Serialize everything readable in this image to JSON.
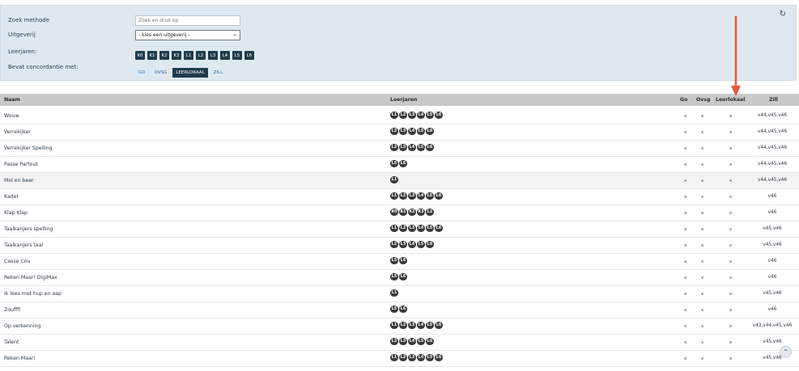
{
  "filters": {
    "search_label": "Zoek methode",
    "search_placeholder": "Zoek en druk op",
    "publisher_label": "Uitgeverij",
    "publisher_value": "- kies een uitgeverij -",
    "years_label": "Leerjaren:",
    "years": [
      "K0",
      "K1",
      "K2",
      "K3",
      "L1",
      "L2",
      "L3",
      "L4",
      "L5",
      "L6"
    ],
    "concordance_label": "Bevat concordantie met:",
    "concordance": [
      "GO",
      "OVSG",
      "LEERLOKAAL",
      "ZILL"
    ],
    "concordance_active": "LEERLOKAAL",
    "refresh_icon": "refresh-icon"
  },
  "table": {
    "headers": {
      "name": "Naam",
      "years": "Leerjaren",
      "go": "Go",
      "ovsg": "Ovsg",
      "leerlokaal": "Leerlokaal",
      "zill": "Zill"
    },
    "rows": [
      {
        "name": "Wouw",
        "years": [
          "L1",
          "L2",
          "L3",
          "L4",
          "L5",
          "L6"
        ],
        "go": "x",
        "ovsg": "x",
        "leerlokaal": "x",
        "zill": "v44,v45,v46"
      },
      {
        "name": "Verrekijker",
        "years": [
          "L2",
          "L3",
          "L4",
          "L5",
          "L6"
        ],
        "go": "x",
        "ovsg": "x",
        "leerlokaal": "x",
        "zill": "v44,v45,v46"
      },
      {
        "name": "Verrekijker Spelling",
        "years": [
          "L2",
          "L3",
          "L4",
          "L5",
          "L6"
        ],
        "go": "x",
        "ovsg": "x",
        "leerlokaal": "x",
        "zill": "v44,v45,v46"
      },
      {
        "name": "Passe Partout",
        "years": [
          "L5",
          "L6"
        ],
        "go": "x",
        "ovsg": "x",
        "leerlokaal": "x",
        "zill": "v44,v45,v46"
      },
      {
        "name": "Mol en beer",
        "years": [
          "L1"
        ],
        "go": "x",
        "ovsg": "x",
        "leerlokaal": "x",
        "zill": "v44,v45,v46"
      },
      {
        "name": "Kadet",
        "years": [
          "L1",
          "L2",
          "L3",
          "L4",
          "L5",
          "L6"
        ],
        "go": "x",
        "ovsg": "x",
        "leerlokaal": "x",
        "zill": "v46"
      },
      {
        "name": "Klap Klap",
        "years": [
          "K0",
          "K1",
          "K2",
          "K3",
          "L2"
        ],
        "go": "x",
        "ovsg": "x",
        "leerlokaal": "x",
        "zill": "v46"
      },
      {
        "name": "Taalkanjers spelling",
        "years": [
          "L1",
          "L2",
          "L3",
          "L4",
          "L5",
          "L6"
        ],
        "go": "x",
        "ovsg": "x",
        "leerlokaal": "x",
        "zill": "v45,v46"
      },
      {
        "name": "Taalkanjers taal",
        "years": [
          "L2",
          "L3",
          "L4",
          "L5",
          "L6"
        ],
        "go": "x",
        "ovsg": "x",
        "leerlokaal": "x",
        "zill": "v45,v46"
      },
      {
        "name": "Casse Cou",
        "years": [
          "L5",
          "L6"
        ],
        "go": "x",
        "ovsg": "x",
        "leerlokaal": "x",
        "zill": "v46"
      },
      {
        "name": "Reken Maar! DigiMax",
        "years": [
          "L5",
          "L6"
        ],
        "go": "x",
        "ovsg": "x",
        "leerlokaal": "x",
        "zill": "v46"
      },
      {
        "name": "ik lees met hup en aap",
        "years": [
          "L1"
        ],
        "go": "x",
        "ovsg": "x",
        "leerlokaal": "x",
        "zill": "v45,v46"
      },
      {
        "name": "Zoufff!",
        "years": [
          "L5",
          "L6"
        ],
        "go": "x",
        "ovsg": "x",
        "leerlokaal": "x",
        "zill": "v46"
      },
      {
        "name": "Op verkenning",
        "years": [
          "L1",
          "L2",
          "L3",
          "L4",
          "L5",
          "L6"
        ],
        "go": "x",
        "ovsg": "x",
        "leerlokaal": "x",
        "zill": "v43,v44,v45,v46"
      },
      {
        "name": "Talent",
        "years": [
          "L2",
          "L3",
          "L4",
          "L5",
          "L6"
        ],
        "go": "x",
        "ovsg": "x",
        "leerlokaal": "x",
        "zill": "v45,v46"
      },
      {
        "name": "Reken Maar!",
        "years": [
          "L1",
          "L2",
          "L3",
          "L4",
          "L5",
          "L6"
        ],
        "go": "x",
        "ovsg": "x",
        "leerlokaal": "x",
        "zill": "v45,v46"
      }
    ]
  },
  "colors": {
    "accent": "#1f3c4c",
    "arrow": "#e8553b",
    "header_bg": "#c9c9c9"
  }
}
